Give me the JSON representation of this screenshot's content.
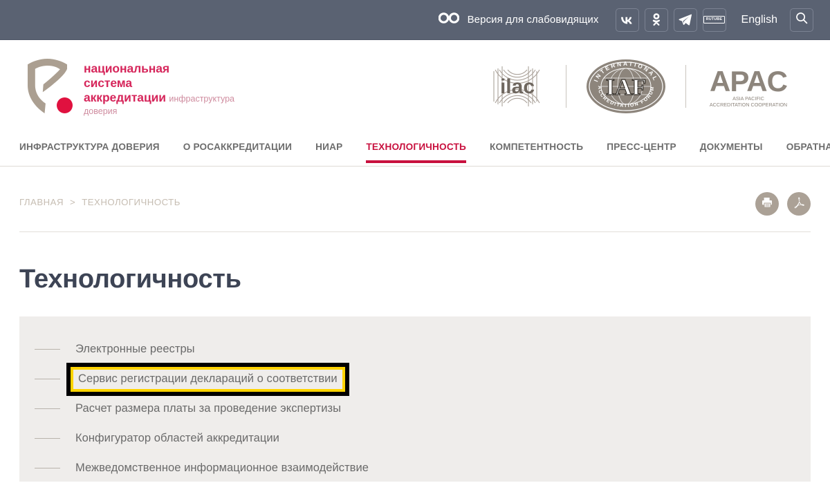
{
  "topbar": {
    "accessibility_label": "Версия для слабовидящих",
    "accessibility_icon": "glasses-icon",
    "social": [
      {
        "name": "vk",
        "label": "VK"
      },
      {
        "name": "odnoklassniki",
        "label": "OK"
      },
      {
        "name": "telegram",
        "label": "Telegram"
      },
      {
        "name": "rutube",
        "label": "RUTUBE"
      }
    ],
    "language_label": "English",
    "search_icon": "search-icon",
    "background": "#5a6272"
  },
  "brand": {
    "title": "национальная\nсистема\nаккредитации",
    "subtitle": "инфраструктура\nдоверия",
    "mark_color": "#ab9f91",
    "dot_color": "#e0113f",
    "title_color": "#d6265b",
    "subtitle_color": "#cf8c9f"
  },
  "accreditation": {
    "logos": [
      {
        "name": "ilac-logo",
        "label": "ilac"
      },
      {
        "name": "iaf-logo",
        "label": "IAF",
        "ring_top": "INTERNATIONAL",
        "ring_bottom": "ACCREDITATION FORUM"
      },
      {
        "name": "apac-logo",
        "label": "APAC",
        "line1": "ASIA PACIFIC",
        "line2": "ACCREDITATION COOPERATION"
      }
    ]
  },
  "nav": {
    "items": [
      {
        "label": "ИНФРАСТРУКТУРА ДОВЕРИЯ",
        "active": false
      },
      {
        "label": "О РОСАККРЕДИТАЦИИ",
        "active": false
      },
      {
        "label": "НИАР",
        "active": false
      },
      {
        "label": "ТЕХНОЛОГИЧНОСТЬ",
        "active": true
      },
      {
        "label": "КОМПЕТЕНТНОСТЬ",
        "active": false
      },
      {
        "label": "ПРЕСС-ЦЕНТР",
        "active": false
      },
      {
        "label": "ДОКУМЕНТЫ",
        "active": false
      },
      {
        "label": "ОБРАТНАЯ СВЯЗЬ",
        "active": false
      }
    ],
    "active_color": "#c8103e",
    "inactive_color": "#6d6d6d"
  },
  "breadcrumb": {
    "home_label": "ГЛАВНАЯ",
    "separator": ">",
    "current_label": "ТЕХНОЛОГИЧНОСТЬ",
    "color": "#c6bdb2"
  },
  "page_tools": [
    {
      "name": "print-button",
      "icon": "printer-icon"
    },
    {
      "name": "pdf-button",
      "icon": "pdf-icon"
    }
  ],
  "main": {
    "title": "Технологичность",
    "links": [
      {
        "label": "Электронные реестры",
        "highlighted": false
      },
      {
        "label": "Сервис регистрации деклараций о соответствии",
        "highlighted": true
      },
      {
        "label": "Расчет размера платы за проведение экспертизы",
        "highlighted": false
      },
      {
        "label": "Конфигуратор областей аккредитации",
        "highlighted": false
      },
      {
        "label": "Межведомственное информационное взаимодействие",
        "highlighted": false
      }
    ],
    "panel_background": "#efedeb",
    "highlight_outline_color": "#000000",
    "highlight_border_color": "#ffd400"
  }
}
